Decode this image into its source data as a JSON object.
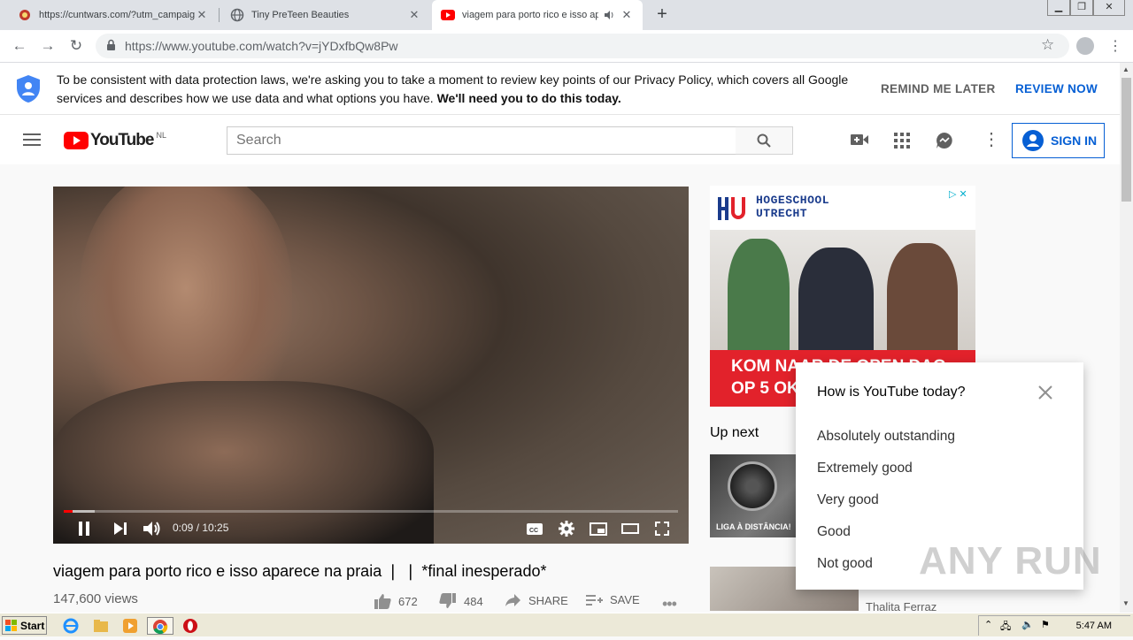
{
  "browser": {
    "tabs": [
      {
        "title": "https://cuntwars.com/?utm_campaig"
      },
      {
        "title": "Tiny PreTeen Beauties"
      },
      {
        "title": "viagem para porto rico e isso ap"
      }
    ],
    "url": "https://www.youtube.com/watch?v=jYDxfbQw8Pw"
  },
  "consent": {
    "text": "To be consistent with data protection laws, we're asking you to take a moment to review key points of our Privacy Policy, which covers all Google services and describes how we use data and what options you have.",
    "bold_text": "We'll need you to do this today.",
    "remind_label": "REMIND ME LATER",
    "review_label": "REVIEW NOW"
  },
  "header": {
    "logo_text": "YouTube",
    "country": "NL",
    "search_placeholder": "Search",
    "signin_label": "SIGN IN"
  },
  "player": {
    "time_current": "0:09",
    "time_total": "10:25",
    "progress": 0.014,
    "buffered": 0.05
  },
  "video": {
    "title": "viagem para porto rico e isso aparece na praia ❘ ❘  *final inesperado*",
    "views": "147,600 views",
    "likes": "672",
    "dislikes": "484",
    "share_label": "SHARE",
    "save_label": "SAVE"
  },
  "ad": {
    "brand_line1": "HOGESCHOOL",
    "brand_line2": "UTRECHT",
    "headline_line1": "KOM NAAR DE OPEN DAG",
    "headline_line2": "OP 5 OKT"
  },
  "sidebar": {
    "up_next": "Up next",
    "related": [
      {
        "caption": "LIGA À DISTÂNCIA!"
      },
      {
        "channel": "Thalita Ferraz"
      }
    ]
  },
  "survey": {
    "question": "How is YouTube today?",
    "options": [
      "Absolutely outstanding",
      "Extremely good",
      "Very good",
      "Good",
      "Not good"
    ]
  },
  "watermark": "ANY RUN",
  "taskbar": {
    "start_label": "Start",
    "clock": "5:47 AM"
  },
  "colors": {
    "accent": "#065fd4",
    "youtube_red": "#ff0000",
    "ad_red": "#e2222b"
  }
}
